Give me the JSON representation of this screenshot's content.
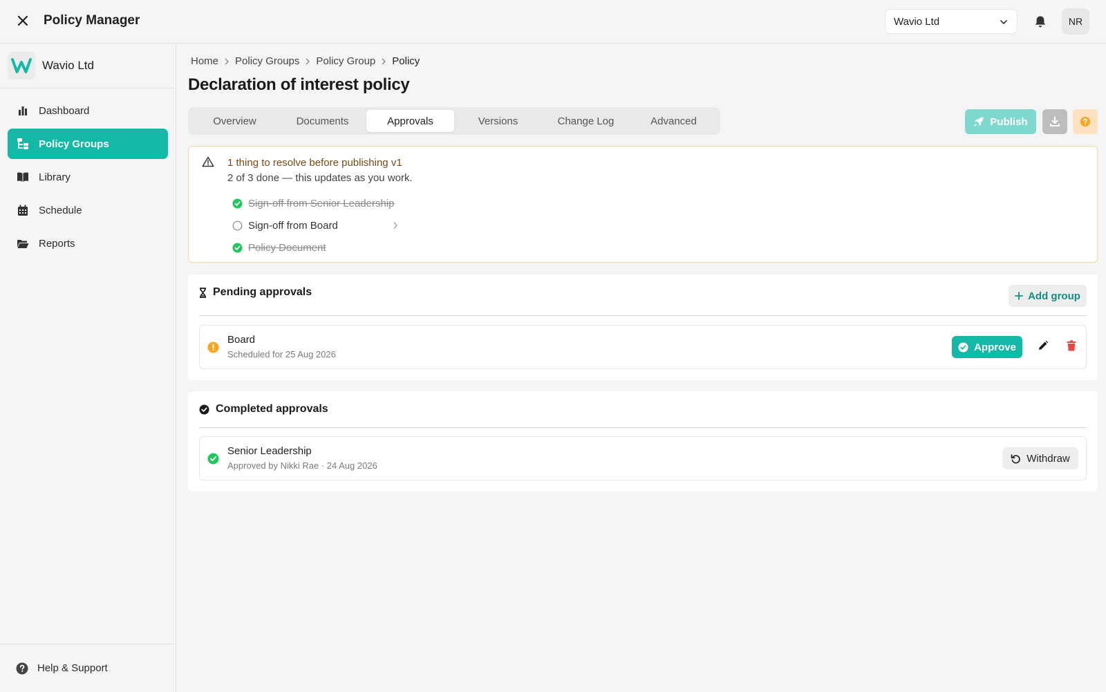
{
  "app": {
    "title": "Policy Manager"
  },
  "header": {
    "org_selected": "Wavio Ltd",
    "avatar_initials": "NR"
  },
  "sidebar": {
    "brand_name": "Wavio Ltd",
    "items": [
      {
        "label": "Dashboard",
        "icon": "bar-chart-icon",
        "active": false
      },
      {
        "label": "Policy Groups",
        "icon": "folder-tree-icon",
        "active": true
      },
      {
        "label": "Library",
        "icon": "book-icon",
        "active": false
      },
      {
        "label": "Schedule",
        "icon": "calendar-icon",
        "active": false
      },
      {
        "label": "Reports",
        "icon": "folder-open-icon",
        "active": false
      }
    ],
    "help_label": "Help & Support"
  },
  "breadcrumb": [
    "Home",
    "Policy Groups",
    "Policy Group",
    "Policy"
  ],
  "page_title": "Declaration of interest policy",
  "tabs": [
    {
      "label": "Overview",
      "active": false
    },
    {
      "label": "Documents",
      "active": false
    },
    {
      "label": "Approvals",
      "active": true
    },
    {
      "label": "Versions",
      "active": false
    },
    {
      "label": "Change Log",
      "active": false
    },
    {
      "label": "Advanced",
      "active": false
    }
  ],
  "toolbar": {
    "publish_label": "Publish"
  },
  "resolve": {
    "title": "1 thing to resolve before publishing v1",
    "subtitle": "2 of 3 done — this updates as you work.",
    "items": [
      {
        "label": "Sign-off from Senior Leadership",
        "done": true
      },
      {
        "label": "Sign-off from Board",
        "done": false
      },
      {
        "label": "Policy Document",
        "done": true
      }
    ]
  },
  "pending": {
    "heading": "Pending approvals",
    "add_group_label": "Add group",
    "rows": [
      {
        "name": "Board",
        "meta": "Scheduled for 25 Aug 2026",
        "approve_label": "Approve"
      }
    ]
  },
  "completed": {
    "heading": "Completed approvals",
    "rows": [
      {
        "name": "Senior Leadership",
        "meta": "Approved by Nikki Rae · 24 Aug 2026",
        "withdraw_label": "Withdraw"
      }
    ]
  },
  "colors": {
    "accent": "#14b8a6",
    "warning": "#f5a623",
    "success": "#22c55e",
    "danger": "#ef4444"
  }
}
